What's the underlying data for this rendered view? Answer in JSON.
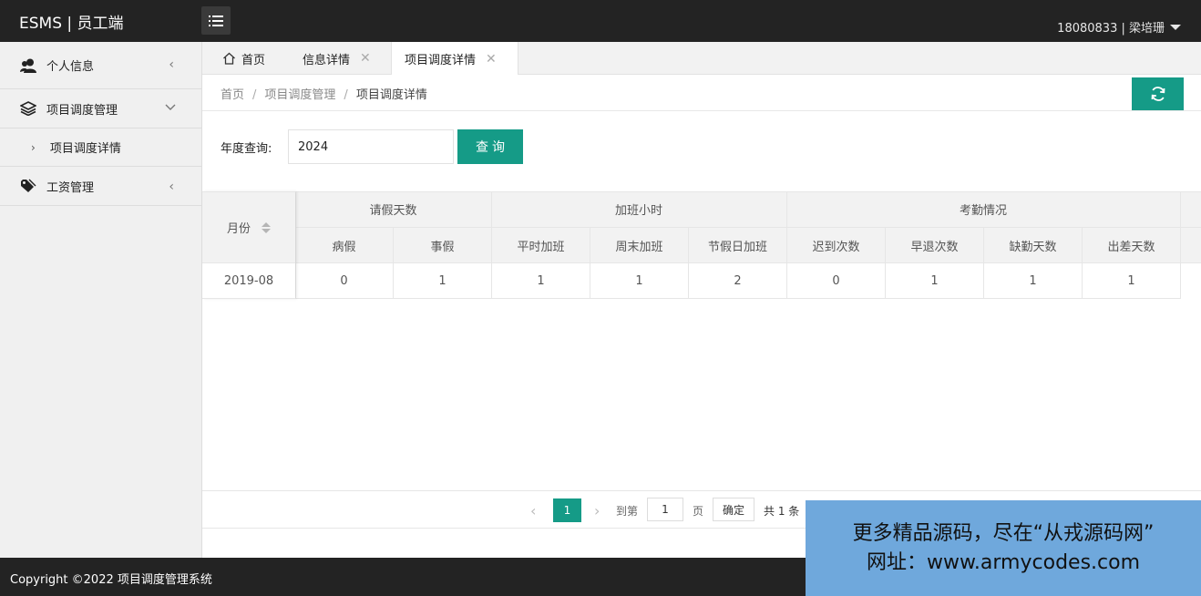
{
  "header": {
    "brand": "ESMS | 员工端",
    "user": "18080833 | 梁培珊"
  },
  "sidebar": {
    "items": [
      {
        "label": "个人信息",
        "icon": "user-icon"
      },
      {
        "label": "项目调度管理",
        "icon": "layers-icon"
      },
      {
        "label": "工资管理",
        "icon": "tag-icon"
      }
    ],
    "sub_items": [
      {
        "label": "项目调度详情"
      }
    ]
  },
  "tabs": [
    {
      "label": "首页",
      "icon": "home-icon"
    },
    {
      "label": "信息详情"
    },
    {
      "label": "项目调度详情",
      "active": true
    }
  ],
  "breadcrumb": {
    "items": [
      "首页",
      "项目调度管理",
      "项目调度详情"
    ],
    "separator": "/"
  },
  "search": {
    "label": "年度查询:",
    "value": "2024",
    "button_label": "查询"
  },
  "table": {
    "month_header": "月份",
    "groups": [
      {
        "label": "请假天数",
        "columns": [
          "病假",
          "事假"
        ]
      },
      {
        "label": "加班小时",
        "columns": [
          "平时加班",
          "周末加班",
          "节假日加班"
        ]
      },
      {
        "label": "考勤情况",
        "columns": [
          "迟到次数",
          "早退次数",
          "缺勤天数",
          "出差天数"
        ]
      }
    ],
    "rows": [
      {
        "month": "2019-08",
        "values": [
          "0",
          "1",
          "1",
          "1",
          "2",
          "0",
          "1",
          "1",
          "1"
        ]
      }
    ]
  },
  "pagination": {
    "current": "1",
    "goto_label": "到第",
    "goto_value": "1",
    "page_label": "页",
    "ok_label": "确定",
    "total_label": "共 1 条"
  },
  "footer": {
    "copyright": "Copyright ©2022 项目调度管理系统"
  },
  "watermark": {
    "line1": "更多精品源码，尽在“从戎源码网”",
    "line2": "网址：www.armycodes.com"
  },
  "colors": {
    "accent": "#159b87",
    "header_bg": "#232323",
    "watermark_bg": "#6fa8dc"
  }
}
